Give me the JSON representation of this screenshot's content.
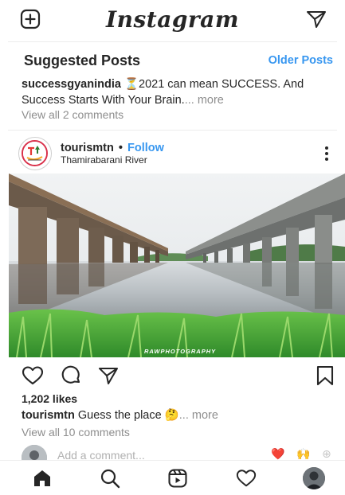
{
  "app": {
    "brand": "Instagram",
    "new_post_icon": "plus-square-icon",
    "direct_icon": "paper-plane-icon"
  },
  "suggested": {
    "title": "Suggested Posts",
    "older_link": "Older Posts"
  },
  "previous_post": {
    "username": "successgyanindia",
    "caption_text": "⏳2021 can mean SUCCESS. And Success Starts With Your Brain.",
    "more": "... more",
    "view_comments": "View all 2 comments"
  },
  "post": {
    "username": "tourismtn",
    "separator": "•",
    "follow_label": "Follow",
    "location": "Thamirabarani River",
    "photo_watermark": "RAWPHOTOGRAPHY",
    "likes": "1,202 likes",
    "caption_text": "Guess the place 🤔",
    "more": "... more",
    "view_comments": "View all 10 comments",
    "comment_placeholder": "Add a comment...",
    "quick_emojis": [
      "❤️",
      "🙌"
    ]
  },
  "nav": {
    "items": [
      "home-icon",
      "search-icon",
      "reels-icon",
      "activity-heart-icon",
      "profile-avatar"
    ]
  },
  "colors": {
    "link_blue": "#3897f0",
    "text": "#262626",
    "muted": "#8e8e8e",
    "heart_red": "#ed4956"
  }
}
